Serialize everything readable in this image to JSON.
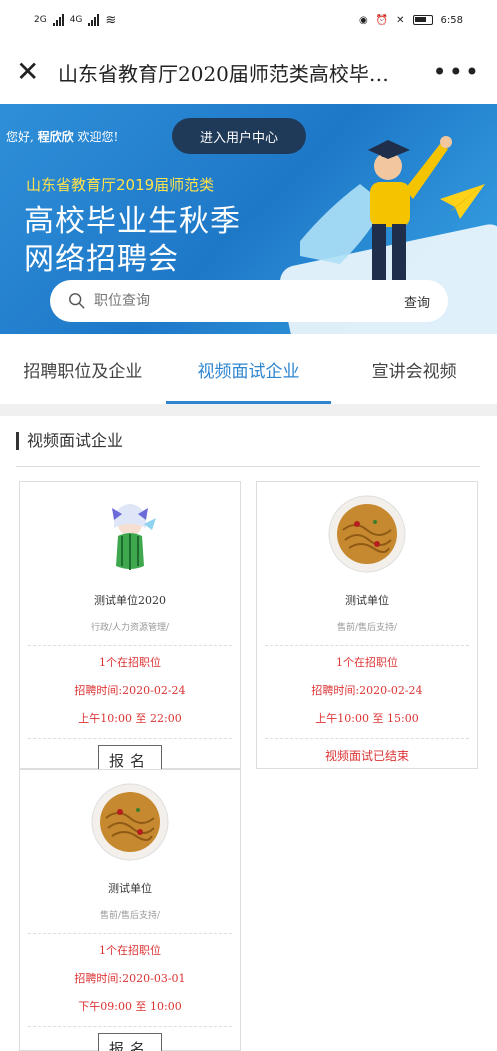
{
  "status": {
    "net1": "2G",
    "net2": "4G",
    "time": "6:58"
  },
  "nav": {
    "title": "山东省教育厅2020届师范类高校毕…"
  },
  "banner": {
    "welcome_prefix": "您好,",
    "user_name": "程欣欣",
    "welcome_suffix": "欢迎您!",
    "user_center_label": "进入用户中心",
    "subtitle": "山东省教育厅2019届师范类",
    "title_line1": "高校毕业生秋季",
    "title_line2": "网络招聘会",
    "search_placeholder": "职位查询",
    "search_button": "查询"
  },
  "tabs": [
    {
      "label": "招聘职位及企业"
    },
    {
      "label": "视频面试企业"
    },
    {
      "label": "宣讲会视频"
    }
  ],
  "section": {
    "title": "视频面试企业"
  },
  "cards": [
    {
      "name": "测试单位2020",
      "category": "行政/人力资源管理/",
      "count": "1个在招职位",
      "time": "招聘时间:2020-02-24",
      "slot": "上午10:00 至 22:00",
      "action": "报名",
      "logo": "anime-character"
    },
    {
      "name": "测试单位",
      "category": "售前/售后支持/",
      "count": "1个在招职位",
      "time": "招聘时间:2020-02-24",
      "slot": "上午10:00 至 15:00",
      "ended": "视频面试已结束",
      "logo": "noodle-dish"
    },
    {
      "name": "测试单位",
      "category": "售前/售后支持/",
      "count": "1个在招职位",
      "time": "招聘时间:2020-03-01",
      "slot": "下午09:00 至 10:00",
      "action": "报名",
      "logo": "noodle-dish"
    }
  ]
}
